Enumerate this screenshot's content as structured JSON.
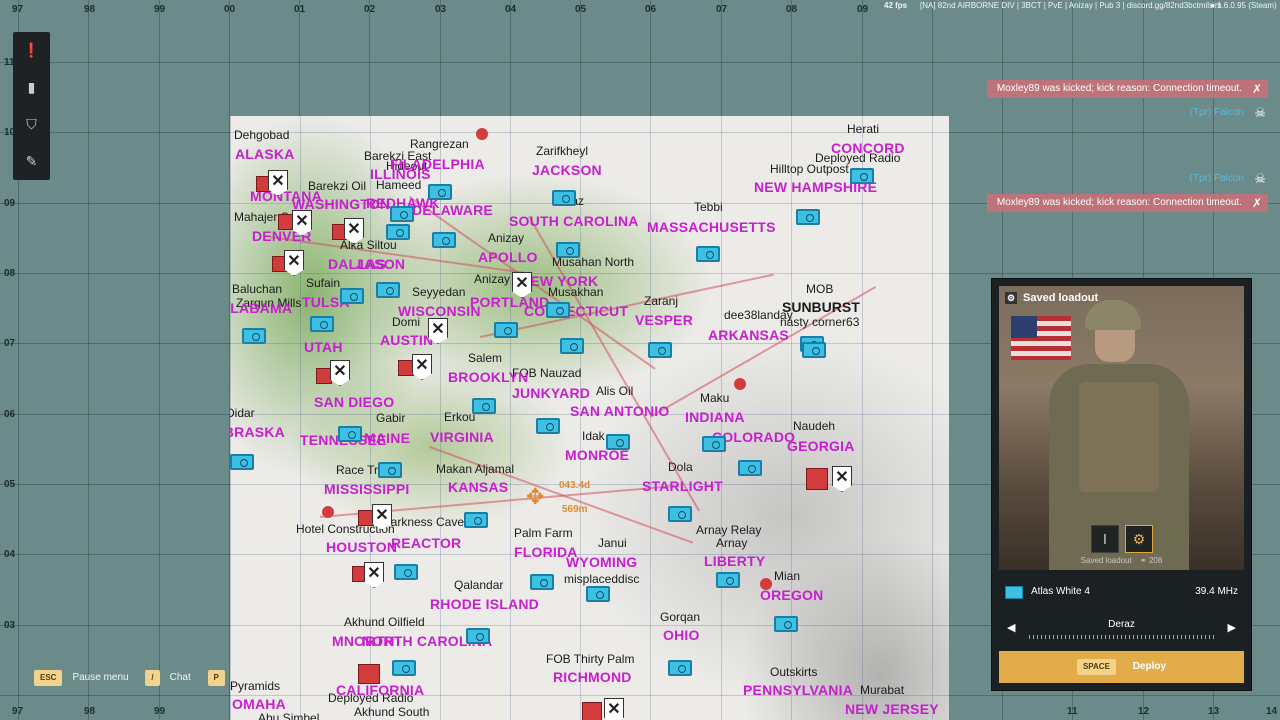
{
  "topbar": {
    "fps": "42 fps",
    "server": "[NA] 82nd AIRBORNE DIV | 3BCT | PvE | Anizay | Pub 3 | discord.gg/82nd3bctmilsim",
    "version": "1.6.0.95 (Steam)"
  },
  "grid": {
    "top_labels": [
      "97",
      "98",
      "99",
      "00",
      "01",
      "02",
      "03",
      "04",
      "05",
      "06",
      "07",
      "08",
      "09"
    ],
    "left_labels": [
      "11",
      "10",
      "09",
      "08",
      "07",
      "06",
      "05",
      "04",
      "03"
    ],
    "bottom_labels": [
      "97",
      "98",
      "99",
      "11",
      "12",
      "13",
      "14"
    ]
  },
  "map": {
    "towns": [
      "Dehgobad",
      "Rangrezan",
      "Herati",
      "Barekzi East",
      "Hideout",
      "Zarifkheyl",
      "Hilltop Outpost",
      "Deployed Radio",
      "Barekzi Oil",
      "Hameed",
      "Deraz",
      "Tebbi",
      "Mahajer South",
      "Alka Siltou",
      "Anizay",
      "Musahan North",
      "Sufain",
      "Baluchan",
      "Zargun Mills",
      "Seyyedan",
      "Anizay City",
      "Musakhan",
      "Zaranj",
      "dee38landay",
      "MOB",
      "SUNBURST",
      "nasty corner63",
      "Domi",
      "Salem",
      "FOB Nauzad",
      "Alis Oil",
      "Maku",
      "Didar",
      "Gabir",
      "Erkou",
      "Idak",
      "Dola",
      "Naudeh",
      "Race Track",
      "Makan Aljamal",
      "Hotel Construction",
      "Darkness Cave",
      "Palm Farm",
      "Janui",
      "Arnay Relay",
      "Arnay",
      "Qalandar",
      "misplaceddisc",
      "Mian",
      "Akhund Oilfield",
      "Gorqan",
      "FOB Thirty Palm",
      "Outskirts",
      "Murabat",
      "Pyramids",
      "Deployed Radio",
      "Akhund South",
      "Abu Simbel"
    ],
    "regions": [
      "ALASKA",
      "MONTANA",
      "WASHINGTON",
      "DENVER",
      "DALLAS",
      "JACKSON",
      "ALABAMA",
      "TULSA",
      "UTAH",
      "SAN DIEGO",
      "NEBRASKA",
      "TENNESSEE",
      "MISSISSIPPI",
      "HOUSTON",
      "MNORTH",
      "CALIFORNIA",
      "OMAHA",
      "FILADELPHIA",
      "ILLINOIS",
      "REDHAWK",
      "DELAWARE",
      "APOLLO",
      "NEW YORK",
      "PORTLAND",
      "CONNECTICUT",
      "SOUTH CAROLINA",
      "MASSACHUSETTS",
      "CONCORD",
      "NEW HAMPSHIRE",
      "VESPER",
      "ARKANSAS",
      "WISCONSIN",
      "AUSTIN",
      "BROOKLYN",
      "JUNKYARD",
      "SAN ANTONIO",
      "INDIANA",
      "VIRGINIA",
      "MAINE",
      "COLORADO",
      "GEORGIA",
      "KANSAS",
      "MONROE",
      "STARLIGHT",
      "REACTOR",
      "FLORIDA",
      "WYOMING",
      "LIBERTY",
      "OREGON",
      "RHODE ISLAND",
      "NORTH CAROLINA",
      "OHIO",
      "RICHMOND",
      "PENNSYLVANIA",
      "NEW JERSEY",
      "JASON"
    ],
    "overlay_texts": [
      "043.4d",
      "569m"
    ]
  },
  "notifications": [
    {
      "text": "Moxley89 was kicked; kick reason: Connection timeout.",
      "icon": "kick-icon",
      "type": "kick"
    },
    {
      "text": "(Tpr) Falcon",
      "icon": "skull-icon",
      "type": "death"
    },
    {
      "text": "(Tpr) Falcon",
      "icon": "skull-icon",
      "type": "death"
    },
    {
      "text": "Moxley89 was kicked; kick reason: Connection timeout.",
      "icon": "kick-icon",
      "type": "kick"
    }
  ],
  "tools": [
    {
      "icon": "info-icon",
      "glyph": "❗"
    },
    {
      "icon": "marker-icon",
      "glyph": "▮"
    },
    {
      "icon": "shield-icon",
      "glyph": "⛉"
    },
    {
      "icon": "pencil-icon",
      "glyph": "✎"
    }
  ],
  "deploy": {
    "loadout_title": "Saved loadout",
    "loadout_footer": "Saved loadout",
    "supply_count": "208",
    "squad_name": "Atlas White 4",
    "frequency": "39.4 MHz",
    "spawn_point": "Deraz",
    "deploy_key": "SPACE",
    "deploy_label": "Deploy",
    "accent": "#e3ac4a"
  },
  "hints": [
    {
      "key": "ESC",
      "label": "Pause menu"
    },
    {
      "key": "/",
      "label": "Chat"
    },
    {
      "key": "P",
      "label": ""
    }
  ]
}
